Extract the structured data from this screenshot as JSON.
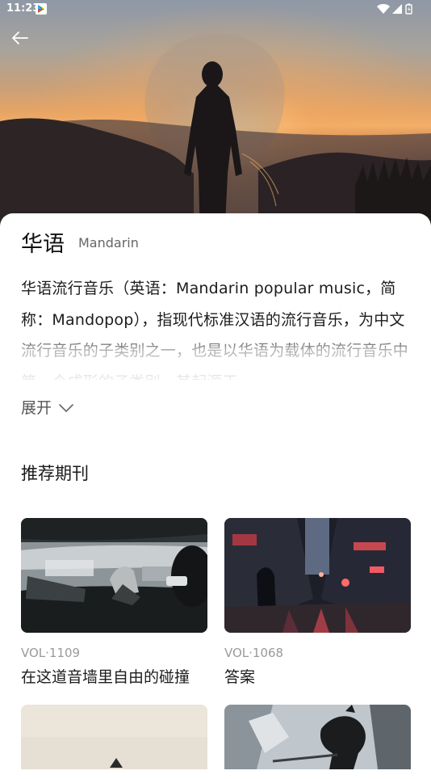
{
  "status_bar": {
    "time": "11:23"
  },
  "header": {
    "back_icon": "arrow-left-icon"
  },
  "genre": {
    "title": "华语",
    "subtitle": "Mandarin",
    "description": "华语流行音乐（英语：Mandarin popular music，简称：Mandopop），指现代标准汉语的流行音乐，为中文流行音乐的子类别之一，也是以华语为载体的流行音乐中第一个成形的子类别，其起源于",
    "expand_label": "展开",
    "expand_icon": "chevron-down-icon"
  },
  "recommended": {
    "section_title": "推荐期刊",
    "items": [
      {
        "vol": "VOL·1109",
        "title": "在这道音墙里自由的碰撞"
      },
      {
        "vol": "VOL·1068",
        "title": "答案"
      },
      {
        "vol": "",
        "title": ""
      },
      {
        "vol": "",
        "title": ""
      }
    ]
  },
  "colors": {
    "accent_text": "#1a1a1a",
    "muted_text": "#9a9a9a",
    "sheet_bg": "#ffffff"
  }
}
